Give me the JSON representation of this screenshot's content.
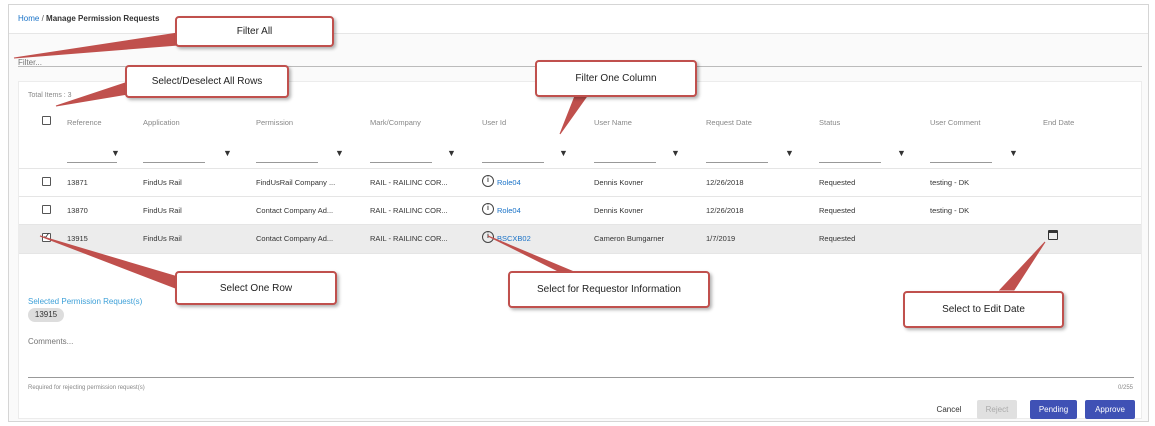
{
  "breadcrumb": {
    "home": "Home",
    "separator": "/",
    "current": "Manage Permission Requests"
  },
  "filter_all": {
    "placeholder": "Filter..."
  },
  "table": {
    "total_items": "Total Items : 3",
    "columns": [
      "Reference",
      "Application",
      "Permission",
      "Mark/Company",
      "User Id",
      "User Name",
      "Request Date",
      "Status",
      "User Comment",
      "End Date"
    ],
    "rows": [
      {
        "checked": false,
        "reference": "13871",
        "application": "FindUs Rail",
        "permission": "FindUsRail Company ...",
        "mark": "RAIL - RAILINC COR...",
        "user_id": "Role04",
        "user_name": "Dennis Kovner",
        "request_date": "12/26/2018",
        "status": "Requested",
        "comment": "testing - DK"
      },
      {
        "checked": false,
        "reference": "13870",
        "application": "FindUs Rail",
        "permission": "Contact Company Ad...",
        "mark": "RAIL - RAILINC COR...",
        "user_id": "Role04",
        "user_name": "Dennis Kovner",
        "request_date": "12/26/2018",
        "status": "Requested",
        "comment": "testing - DK"
      },
      {
        "checked": true,
        "reference": "13915",
        "application": "FindUs Rail",
        "permission": "Contact Company Ad...",
        "mark": "RAIL - RAILINC COR...",
        "user_id": "BSCXB02",
        "user_name": "Cameron Bumgarner",
        "request_date": "1/7/2019",
        "status": "Requested",
        "comment": ""
      }
    ]
  },
  "selection": {
    "label": "Selected Permission Request(s)",
    "chip": "13915"
  },
  "comments": {
    "placeholder": "Comments...",
    "required_note": "Required for rejecting permission request(s)",
    "counter": "0/255"
  },
  "buttons": {
    "cancel": "Cancel",
    "reject": "Reject",
    "pending": "Pending",
    "approve": "Approve"
  },
  "callouts": {
    "filter_all": "Filter All",
    "select_all": "Select/Deselect All Rows",
    "filter_column": "Filter One Column",
    "select_row": "Select One Row",
    "requestor_info": "Select for Requestor Information",
    "edit_date": "Select to Edit Date"
  },
  "colors": {
    "accent": "#3f51b5",
    "link": "#1a73c8",
    "callout_border": "#c0504d",
    "selected_label": "#3da0d8"
  }
}
